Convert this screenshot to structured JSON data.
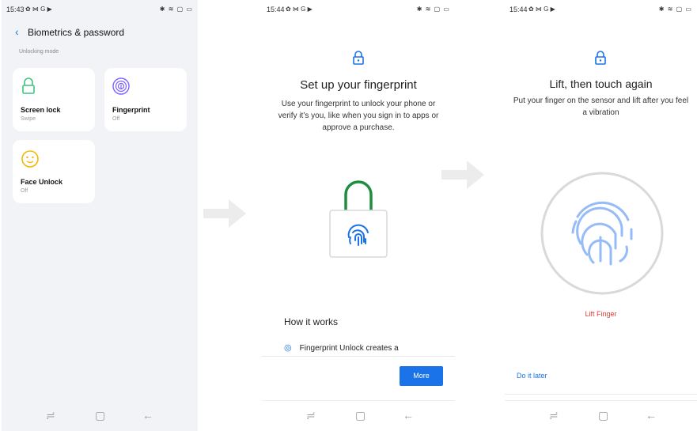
{
  "screen1": {
    "status": {
      "time": "15:43",
      "left_icons": "✿ ⋈ G ▶",
      "right_icons": "✱ ≋ ▢ ▭"
    },
    "header": {
      "title": "Biometrics & password"
    },
    "section_label": "Unlocking mode",
    "cards": [
      {
        "label": "Screen lock",
        "sub": "Swipe",
        "icon": "lock-icon",
        "color": "#3cc47c"
      },
      {
        "label": "Fingerprint",
        "sub": "Off",
        "icon": "fingerprint-icon",
        "color": "#7b61ff"
      },
      {
        "label": "Face Unlock",
        "sub": "Off",
        "icon": "face-icon",
        "color": "#f5b800"
      }
    ]
  },
  "screen2": {
    "status": {
      "time": "15:44",
      "left_icons": "✿ ⋈ G ▶",
      "right_icons": "✱ ≋ ▢ ▭"
    },
    "heading": "Set up your fingerprint",
    "body": "Use your fingerprint to unlock your phone or verify it’s you, like when you sign in to apps or approve a purchase.",
    "how_it_works": {
      "title": "How it works",
      "item": "Fingerprint Unlock creates a"
    },
    "more_button": "More",
    "accent": "#1a73e8",
    "padlock_shackle": "#1e8e3e"
  },
  "screen3": {
    "status": {
      "time": "15:44",
      "left_icons": "✿ ⋈ G ▶",
      "right_icons": "✱ ≋ ▢ ▭"
    },
    "heading": "Lift, then touch again",
    "body": "Put your finger on the sensor and lift after you feel a vibration",
    "lift_label": "Lift Finger",
    "do_it_later": "Do it later"
  }
}
